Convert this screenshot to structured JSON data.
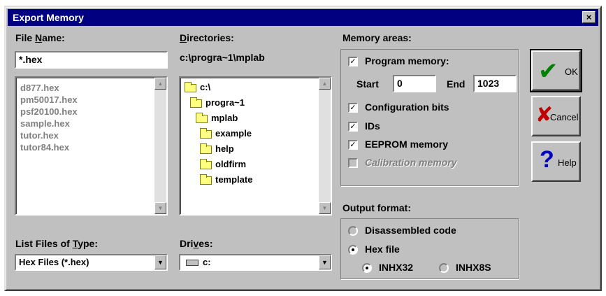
{
  "window": {
    "title": "Export Memory",
    "close_glyph": "×"
  },
  "file_name": {
    "label_pre": "File ",
    "label_ul": "N",
    "label_post": "ame:",
    "value": "*.hex",
    "files": [
      "d877.hex",
      "pm50017.hex",
      "psf20100.hex",
      "sample.hex",
      "tutor.hex",
      "tutor84.hex"
    ]
  },
  "directories": {
    "label_ul": "D",
    "label_post": "irectories:",
    "current_path": "c:\\progra~1\\mplab",
    "tree": [
      "c:\\",
      "progra~1",
      "mplab",
      "example",
      "help",
      "oldfirm",
      "template"
    ]
  },
  "file_type": {
    "label_pre": "List Files of ",
    "label_ul": "T",
    "label_post": "ype:",
    "value": "Hex Files (*.hex)"
  },
  "drives": {
    "label_pre": "Dri",
    "label_ul": "v",
    "label_post": "es:",
    "value": "c:"
  },
  "memory_areas": {
    "label": "Memory areas:",
    "program_memory": {
      "label": "Program memory:",
      "checked": true
    },
    "start": {
      "label": "Start",
      "value": "0"
    },
    "end": {
      "label": "End",
      "value": "1023"
    },
    "configuration_bits": {
      "label": "Configuration bits",
      "checked": true
    },
    "ids": {
      "label": "IDs",
      "checked": true
    },
    "eeprom": {
      "label": "EEPROM memory",
      "checked": true
    },
    "calibration": {
      "label": "Calibration memory",
      "checked": false,
      "disabled": true
    }
  },
  "output_format": {
    "label": "Output format:",
    "disassembled": {
      "label": "Disassembled code",
      "selected": false
    },
    "hex_file": {
      "label": "Hex file",
      "selected": true
    },
    "inhx32": {
      "label": "INHX32",
      "selected": true
    },
    "inhx8s": {
      "label": "INHX8S",
      "selected": false
    }
  },
  "buttons": {
    "ok": {
      "label": "OK",
      "glyph": "✔",
      "color": "#008000"
    },
    "cancel": {
      "label": "Cancel",
      "glyph": "✘",
      "color": "#c00000"
    },
    "help": {
      "label": "Help",
      "glyph": "?",
      "color": "#0000c0"
    }
  },
  "check_glyph": "✓",
  "colors": {
    "title_bar": "#000080",
    "face": "#c0c0c0",
    "folder": "#ffff80"
  }
}
